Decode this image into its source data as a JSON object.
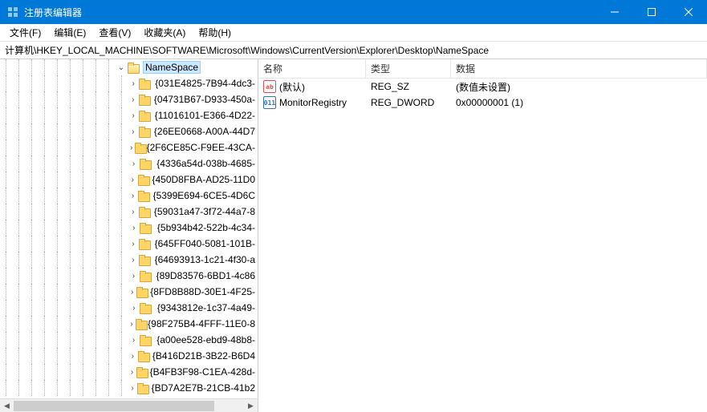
{
  "window": {
    "title": "注册表编辑器"
  },
  "menu": {
    "file": "文件(F)",
    "edit": "编辑(E)",
    "view": "查看(V)",
    "favorites": "收藏夹(A)",
    "help": "帮助(H)"
  },
  "path": "计算机\\HKEY_LOCAL_MACHINE\\SOFTWARE\\Microsoft\\Windows\\CurrentVersion\\Explorer\\Desktop\\NameSpace",
  "tree": {
    "selected": "NameSpace",
    "children": [
      "{031E4825-7B94-4dc3-",
      "{04731B67-D933-450a-",
      "{11016101-E366-4D22-",
      "{26EE0668-A00A-44D7",
      "{2F6CE85C-F9EE-43CA-",
      "{4336a54d-038b-4685-",
      "{450D8FBA-AD25-11D0",
      "{5399E694-6CE5-4D6C",
      "{59031a47-3f72-44a7-8",
      "{5b934b42-522b-4c34-",
      "{645FF040-5081-101B-",
      "{64693913-1c21-4f30-a",
      "{89D83576-6BD1-4c86",
      "{8FD8B88D-30E1-4F25-",
      "{9343812e-1c37-4a49-",
      "{98F275B4-4FFF-11E0-8",
      "{a00ee528-ebd9-48b8-",
      "{B416D21B-3B22-B6D4",
      "{B4FB3F98-C1EA-428d-",
      "{BD7A2E7B-21CB-41b2"
    ]
  },
  "list": {
    "headers": {
      "name": "名称",
      "type": "类型",
      "data": "数据"
    },
    "rows": [
      {
        "icon": "sz",
        "iconText": "ab",
        "name": "(默认)",
        "type": "REG_SZ",
        "data": "(数值未设置)"
      },
      {
        "icon": "dw",
        "iconText": "011",
        "name": "MonitorRegistry",
        "type": "REG_DWORD",
        "data": "0x00000001 (1)"
      }
    ]
  }
}
